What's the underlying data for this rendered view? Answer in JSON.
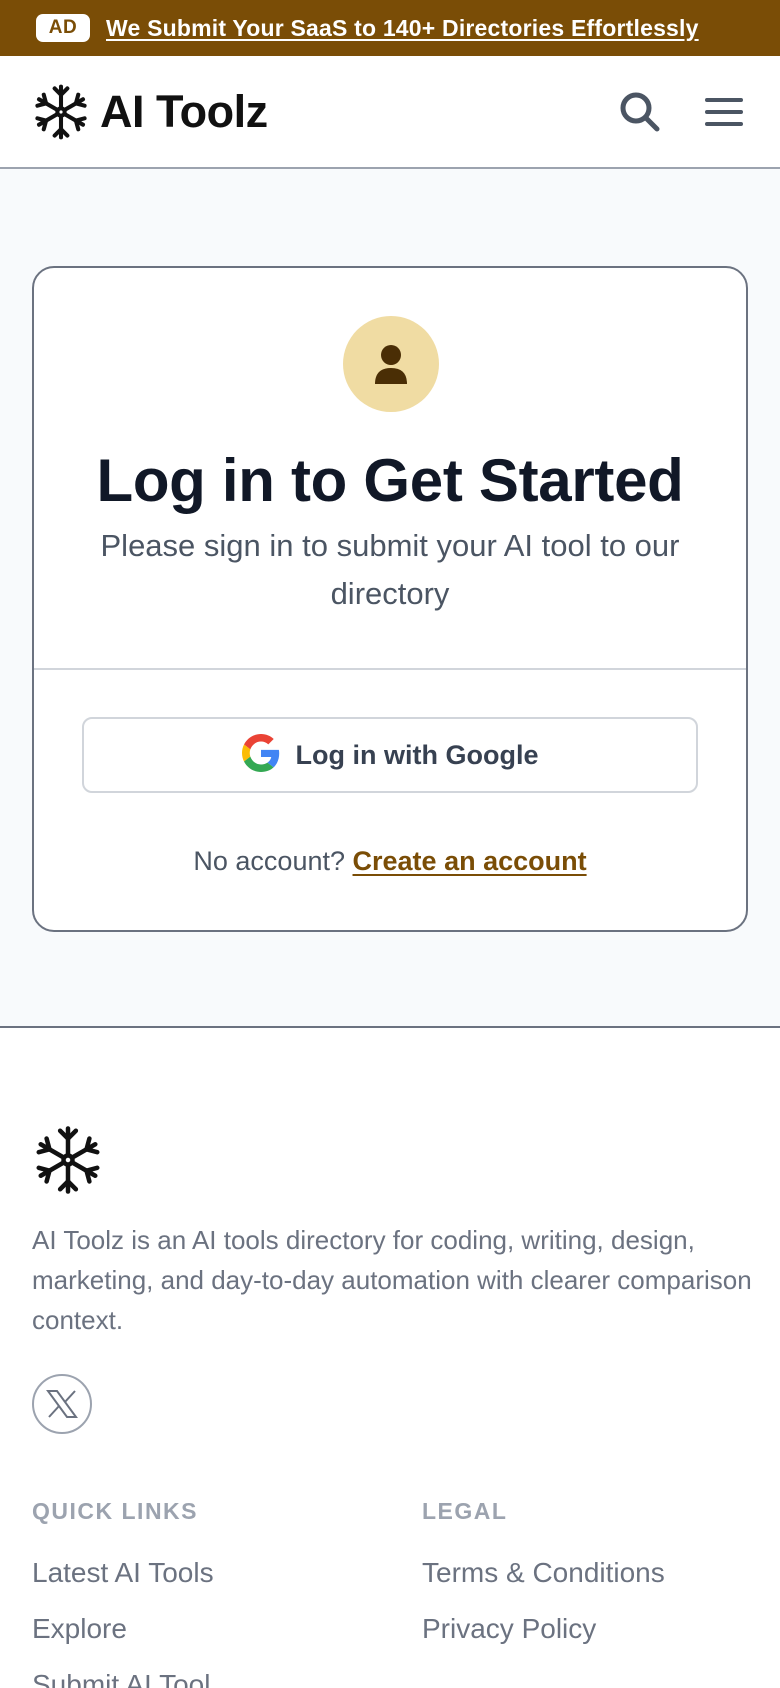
{
  "ad": {
    "badge": "AD",
    "text": "We Submit Your SaaS to 140+ Directories Effortlessly"
  },
  "header": {
    "brand_name": "AI Toolz",
    "logo_icon": "snowflake-icon",
    "search_icon": "search-icon",
    "menu_icon": "hamburger-menu-icon"
  },
  "login_card": {
    "avatar_icon": "user-icon",
    "title": "Log in to Get Started",
    "subtitle": "Please sign in to submit your AI tool to our directory",
    "google_button": "Log in with Google",
    "no_account_text": "No account?",
    "create_account_link": "Create an account"
  },
  "footer": {
    "logo_icon": "snowflake-icon",
    "about": "AI Toolz is an AI tools directory for coding, writing, design, marketing, and day-to-day automation with clearer comparison context.",
    "social_icon": "x-twitter-icon",
    "quick_links": {
      "heading": "QUICK LINKS",
      "items": [
        "Latest AI Tools",
        "Explore",
        "Submit AI Tool"
      ]
    },
    "legal": {
      "heading": "LEGAL",
      "items": [
        "Terms & Conditions",
        "Privacy Policy"
      ]
    }
  },
  "colors": {
    "accent": "#7a4d06",
    "avatar_bg": "#f0dca3",
    "page_bg": "#f8fafc"
  }
}
